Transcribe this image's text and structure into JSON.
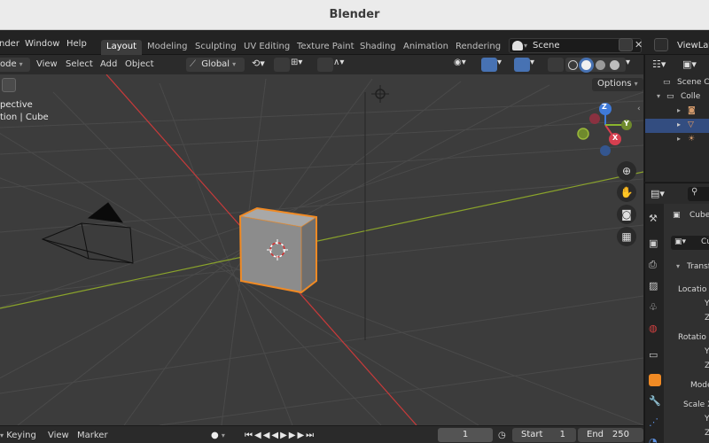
{
  "window": {
    "title": "Blender"
  },
  "menu": [
    {
      "label": "nder",
      "x": -1
    },
    {
      "label": "Window",
      "x": 28
    },
    {
      "label": "Help",
      "x": 75
    }
  ],
  "workspaces": [
    {
      "label": "Layout",
      "active": true
    },
    {
      "label": "Modeling"
    },
    {
      "label": "Sculpting"
    },
    {
      "label": "UV Editing"
    },
    {
      "label": "Texture Paint"
    },
    {
      "label": "Shading"
    },
    {
      "label": "Animation"
    },
    {
      "label": "Rendering"
    }
  ],
  "scene": {
    "label": "Scene"
  },
  "view_layer": {
    "label": "ViewLay"
  },
  "viewport_header": {
    "mode": "ode",
    "view": "View",
    "select": "Select",
    "add": "Add",
    "object": "Object",
    "orientation": "Global"
  },
  "viewport": {
    "overlay_line1": "pective",
    "overlay_line2": "tion | Cube",
    "options": "Options",
    "gizmo": {
      "z": "Z",
      "x": "X",
      "y": "Y"
    }
  },
  "timeline": {
    "keying": "Keying",
    "view": "View",
    "marker": "Marker",
    "current_frame": "1",
    "start_label": "Start",
    "start_value": "1",
    "end_label": "End",
    "end_value": "250"
  },
  "outliner": {
    "scene_collection": "Scene Co",
    "collection": "Colle"
  },
  "properties": {
    "object_name": "Cube",
    "object_name_field": "Cu",
    "transform": "Transf",
    "location": "Locatio",
    "y": "Y",
    "z": "Z",
    "rotation": "Rotatio",
    "mode": "Mode",
    "scale": "Scale X"
  },
  "colors": {
    "accent_blue": "#4772b3",
    "selection_orange": "#f08a24",
    "axis_red": "#c83a3a",
    "axis_green": "#8aa32b",
    "gizmo_x": "#d63f4f",
    "gizmo_y": "#8ab52e",
    "gizmo_z": "#3f7ad9"
  }
}
